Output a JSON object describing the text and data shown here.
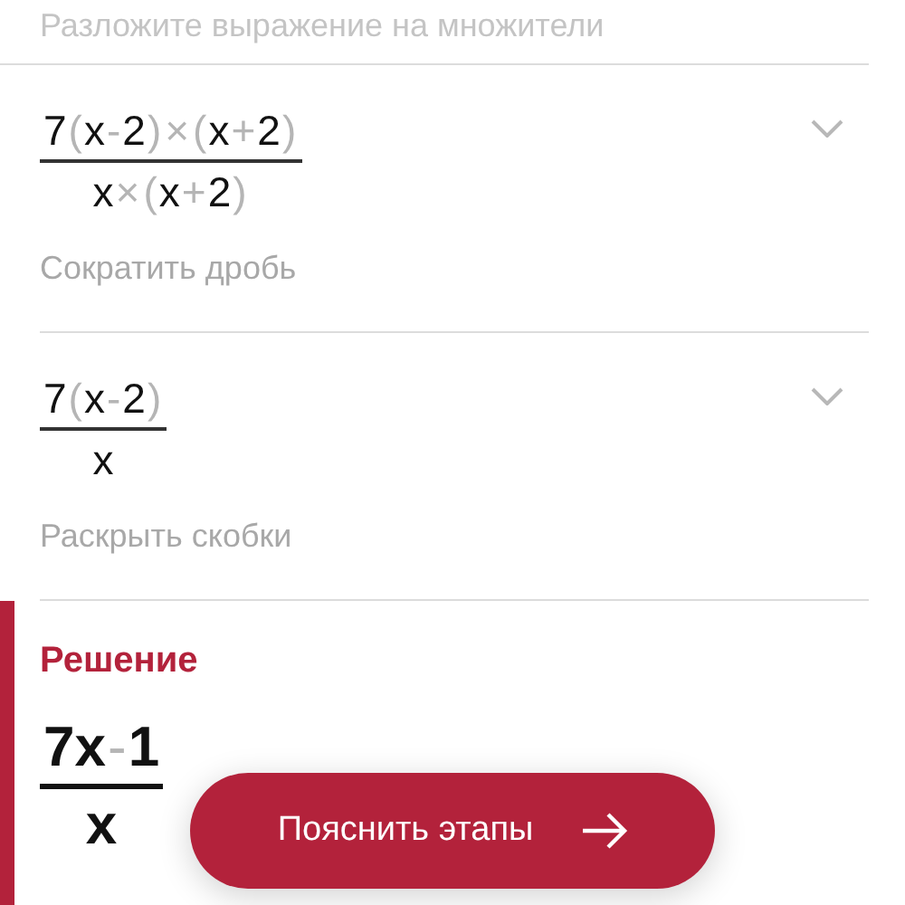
{
  "top_caption": "Разложите выражение на множители",
  "steps": [
    {
      "numerator": [
        {
          "t": "7",
          "kind": "term"
        },
        {
          "t": "(",
          "kind": "op"
        },
        {
          "t": "x",
          "kind": "term"
        },
        {
          "t": "-",
          "kind": "op"
        },
        {
          "t": "2",
          "kind": "term"
        },
        {
          "t": ")",
          "kind": "op"
        },
        {
          "t": "×",
          "kind": "op"
        },
        {
          "t": "(",
          "kind": "op"
        },
        {
          "t": "x",
          "kind": "term"
        },
        {
          "t": "+",
          "kind": "op"
        },
        {
          "t": "2",
          "kind": "term"
        },
        {
          "t": ")",
          "kind": "op"
        }
      ],
      "denominator": [
        {
          "t": "x",
          "kind": "term"
        },
        {
          "t": "×",
          "kind": "op"
        },
        {
          "t": "(",
          "kind": "op"
        },
        {
          "t": "x",
          "kind": "term"
        },
        {
          "t": "+",
          "kind": "op"
        },
        {
          "t": "2",
          "kind": "term"
        },
        {
          "t": ")",
          "kind": "op"
        }
      ],
      "caption": "Сократить дробь",
      "expanded": false
    },
    {
      "numerator": [
        {
          "t": "7",
          "kind": "term"
        },
        {
          "t": "(",
          "kind": "op"
        },
        {
          "t": "x",
          "kind": "term"
        },
        {
          "t": "-",
          "kind": "op"
        },
        {
          "t": "2",
          "kind": "term"
        },
        {
          "t": ")",
          "kind": "op"
        }
      ],
      "denominator": [
        {
          "t": "x",
          "kind": "term"
        }
      ],
      "caption": "Раскрыть скобки",
      "expanded": false
    }
  ],
  "solution": {
    "title": "Решение",
    "numerator": [
      {
        "t": "7",
        "kind": "term"
      },
      {
        "t": "x",
        "kind": "term"
      },
      {
        "t": "-",
        "kind": "op"
      },
      {
        "t": "1",
        "kind": "term"
      }
    ],
    "denominator": [
      {
        "t": "x",
        "kind": "term"
      }
    ]
  },
  "button": {
    "label": "Пояснить этапы"
  }
}
